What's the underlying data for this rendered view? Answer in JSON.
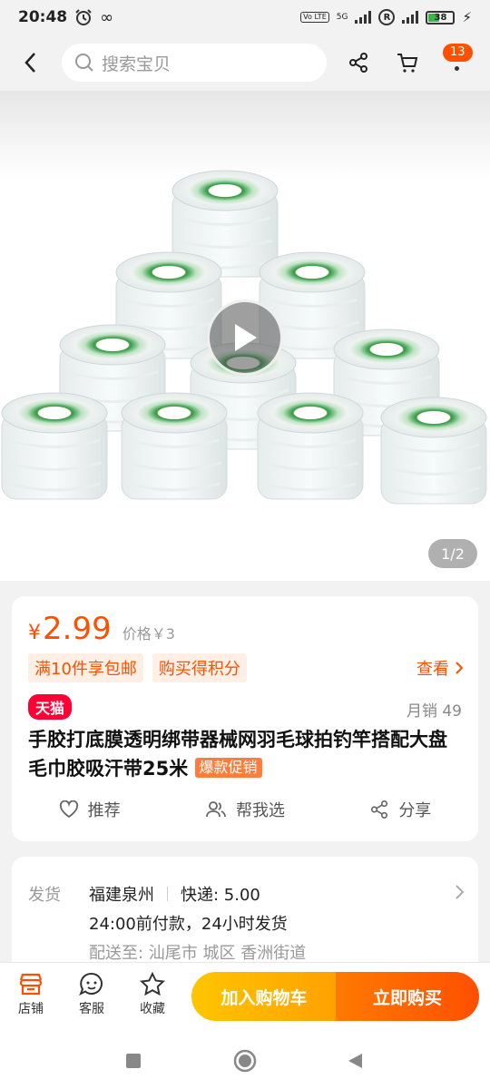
{
  "status_bar": {
    "time": "20:48",
    "infinity": "∞",
    "volte": "Vo LTE",
    "net": "5G",
    "roam": "R",
    "battery": "38"
  },
  "search": {
    "placeholder": "搜索宝贝"
  },
  "header": {
    "cart_badge": "13"
  },
  "gallery": {
    "pager": "1/2"
  },
  "product": {
    "currency": "¥",
    "price": "2.99",
    "original_price": "价格￥3",
    "promos": [
      "满10件享包邮",
      "购买得积分"
    ],
    "view_label": "查看",
    "store_badge": "天猫",
    "monthly_sales": "月销 49",
    "title": "手胶打底膜透明绑带器械网羽毛球拍钓竿搭配大盘毛巾胶吸汗带25米",
    "hot_tag": "爆款促销",
    "actions": {
      "recommend": "推荐",
      "help_choose": "帮我选",
      "share": "分享"
    }
  },
  "shipping": {
    "label": "发货",
    "origin": "福建泉州",
    "fee": "快递: 5.00",
    "promise": "24:00前付款，24小时发货",
    "deliver_to": "配送至: 汕尾市 城区 香洲街道"
  },
  "bottom_bar": {
    "store": "店铺",
    "service": "客服",
    "favorite": "收藏",
    "add_to_cart": "加入购物车",
    "buy_now": "立即购买"
  },
  "colors": {
    "accent": "#ff5000",
    "tmall": "#ff0036",
    "cart_button": "#ffb300",
    "buy_button": "#ff5a00"
  }
}
